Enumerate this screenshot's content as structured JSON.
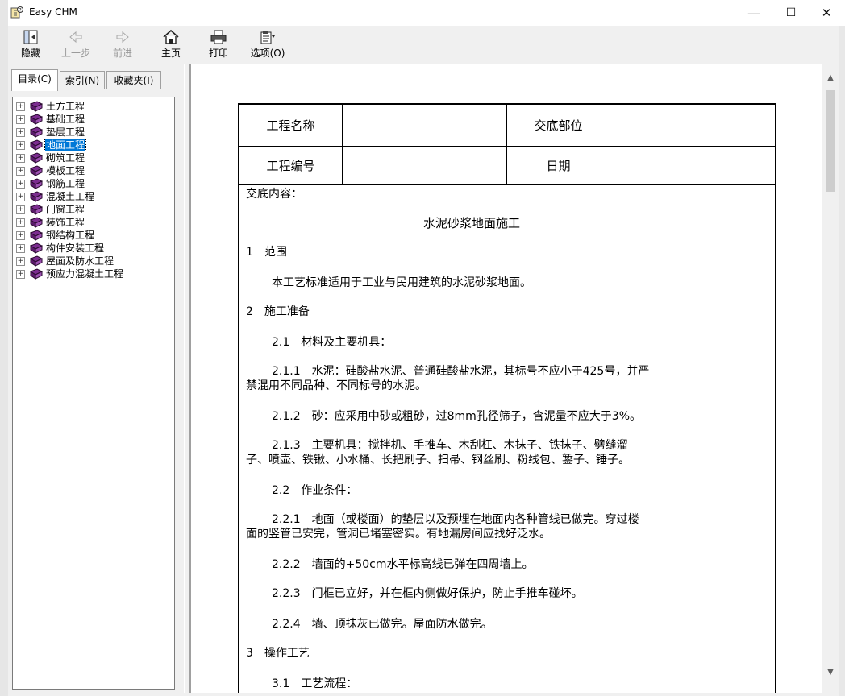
{
  "window": {
    "title": "Easy CHM",
    "minimize": "—",
    "maximize": "☐",
    "close": "✕"
  },
  "toolbar": {
    "hide": "隐藏",
    "back": "上一步",
    "forward": "前进",
    "home": "主页",
    "print": "打印",
    "options": "选项(O)"
  },
  "tabs": {
    "contents": "目录(C)",
    "index": "索引(N)",
    "favorites": "收藏夹(I)"
  },
  "tree": {
    "items": [
      {
        "label": "土方工程",
        "selected": false
      },
      {
        "label": "基础工程",
        "selected": false
      },
      {
        "label": "垫层工程",
        "selected": false
      },
      {
        "label": "地面工程",
        "selected": true
      },
      {
        "label": "砌筑工程",
        "selected": false
      },
      {
        "label": "模板工程",
        "selected": false
      },
      {
        "label": "钢筋工程",
        "selected": false
      },
      {
        "label": "混凝土工程",
        "selected": false
      },
      {
        "label": "门窗工程",
        "selected": false
      },
      {
        "label": "装饰工程",
        "selected": false
      },
      {
        "label": "钢结构工程",
        "selected": false
      },
      {
        "label": "构件安装工程",
        "selected": false
      },
      {
        "label": "屋面及防水工程",
        "selected": false
      },
      {
        "label": "预应力混凝土工程",
        "selected": false
      }
    ]
  },
  "document": {
    "header": {
      "project_name_label": "工程名称",
      "project_name_value": "",
      "handover_part_label": "交底部位",
      "handover_part_value": "",
      "project_no_label": "工程编号",
      "project_no_value": "",
      "date_label": "日期",
      "date_value": ""
    },
    "lines": [
      "交底内容：",
      "水泥砂浆地面施工",
      "1　范围",
      "本工艺标准适用于工业与民用建筑的水泥砂浆地面。",
      "2　施工准备",
      "2.1　材料及主要机具：",
      "2.1.1　水泥：硅酸盐水泥、普通硅酸盐水泥，其标号不应小于425号，并严",
      "禁混用不同品种、不同标号的水泥。",
      "2.1.2　砂：应采用中砂或粗砂，过8mm孔径筛子，含泥量不应大于3%。",
      "2.1.3　主要机具：搅拌机、手推车、木刮杠、木抹子、铁抹子、劈缝溜",
      "子、喷壶、铁锹、小水桶、长把刷子、扫帚、钢丝刷、粉线包、錾子、锤子。",
      "2.2　作业条件：",
      "2.2.1　地面（或楼面）的垫层以及预埋在地面内各种管线已做完。穿过楼",
      "面的竖管已安完，管洞已堵塞密实。有地漏房间应找好泛水。",
      "2.2.2　墙面的+50cm水平标高线已弹在四周墙上。",
      "2.2.3　门框已立好，并在框内侧做好保护，防止手推车碰坏。",
      "2.2.4　墙、顶抹灰已做完。屋面防水做完。",
      "3　操作工艺",
      "3.1　工艺流程："
    ]
  },
  "icons": {
    "title": "chm-help-icon",
    "hide": "hide-pane-icon",
    "back": "back-arrow-icon",
    "forward": "forward-arrow-icon",
    "home": "home-icon",
    "print": "printer-icon",
    "options": "options-icon",
    "book": "book-icon"
  },
  "colors": {
    "selection": "#0078d7",
    "book": "#7b2c8f"
  }
}
